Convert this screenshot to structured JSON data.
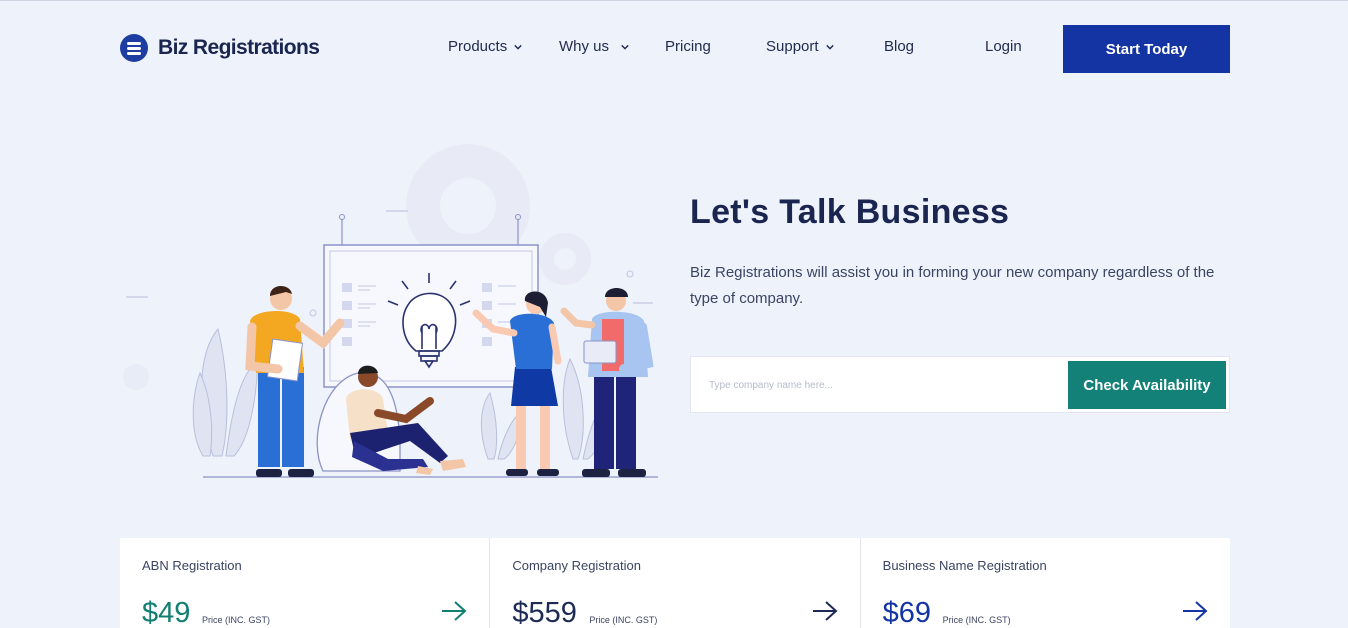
{
  "header": {
    "brand": "Biz Registrations",
    "nav": [
      {
        "label": "Products",
        "has_dropdown": true
      },
      {
        "label": "Why us",
        "has_dropdown": true
      },
      {
        "label": "Pricing",
        "has_dropdown": false
      },
      {
        "label": "Support",
        "has_dropdown": true
      },
      {
        "label": "Blog",
        "has_dropdown": false
      }
    ],
    "login_label": "Login",
    "cta_label": "Start Today"
  },
  "hero": {
    "title": "Let's Talk Business",
    "subtitle": "Biz Registrations will assist you in forming your new company regardless of the type of company.",
    "search_placeholder": "Type company name here...",
    "search_value": "",
    "check_label": "Check Availability",
    "illustration": "team-brainstorming-lightbulb-illustration"
  },
  "cards": [
    {
      "title": "ABN Registration",
      "price": "$49",
      "note": "Price (INC. GST)",
      "color": "#137f73"
    },
    {
      "title": "Company Registration",
      "price": "$559",
      "note": "Price (INC. GST)",
      "color": "#1c2a55"
    },
    {
      "title": "Business Name Registration",
      "price": "$69",
      "note": "Price (INC. GST)",
      "color": "#1434a4"
    }
  ],
  "colors": {
    "background": "#eef2fa",
    "primary": "#1434a4",
    "teal": "#138178",
    "text": "#1a2550"
  }
}
